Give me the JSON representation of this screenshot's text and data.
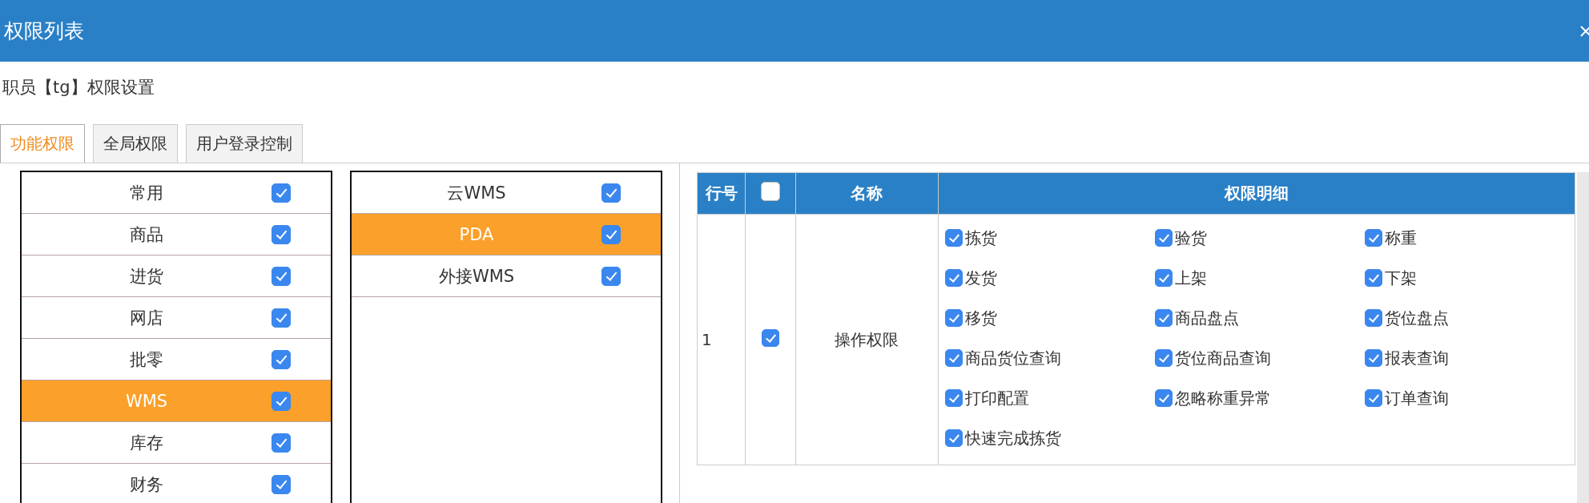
{
  "window": {
    "title": "权限列表"
  },
  "heading": "职员【tg】权限设置",
  "tabs": [
    {
      "label": "功能权限",
      "selected": true
    },
    {
      "label": "全局权限",
      "selected": false
    },
    {
      "label": "用户登录控制",
      "selected": false
    }
  ],
  "modules": [
    {
      "label": "常用",
      "checked": true,
      "selected": false
    },
    {
      "label": "商品",
      "checked": true,
      "selected": false
    },
    {
      "label": "进货",
      "checked": true,
      "selected": false
    },
    {
      "label": "网店",
      "checked": true,
      "selected": false
    },
    {
      "label": "批零",
      "checked": true,
      "selected": false
    },
    {
      "label": "WMS",
      "checked": true,
      "selected": true
    },
    {
      "label": "库存",
      "checked": true,
      "selected": false
    },
    {
      "label": "财务",
      "checked": true,
      "selected": false
    }
  ],
  "submodules": [
    {
      "label": "云WMS",
      "checked": true,
      "selected": false
    },
    {
      "label": "PDA",
      "checked": true,
      "selected": true
    },
    {
      "label": "外接WMS",
      "checked": true,
      "selected": false
    }
  ],
  "table": {
    "columns": {
      "row_no": "行号",
      "name": "名称",
      "detail": "权限明细"
    },
    "select_all_checked": false,
    "rows": [
      {
        "row_no": "1",
        "checked": true,
        "name": "操作权限",
        "permissions": [
          {
            "label": "拣货",
            "checked": true
          },
          {
            "label": "验货",
            "checked": true
          },
          {
            "label": "称重",
            "checked": true
          },
          {
            "label": "发货",
            "checked": true
          },
          {
            "label": "上架",
            "checked": true
          },
          {
            "label": "下架",
            "checked": true
          },
          {
            "label": "移货",
            "checked": true
          },
          {
            "label": "商品盘点",
            "checked": true
          },
          {
            "label": "货位盘点",
            "checked": true
          },
          {
            "label": "商品货位查询",
            "checked": true
          },
          {
            "label": "货位商品查询",
            "checked": true
          },
          {
            "label": "报表查询",
            "checked": true
          },
          {
            "label": "打印配置",
            "checked": true
          },
          {
            "label": "忽略称重异常",
            "checked": true
          },
          {
            "label": "订单查询",
            "checked": true
          },
          {
            "label": "快速完成拣货",
            "checked": true
          }
        ]
      }
    ]
  }
}
